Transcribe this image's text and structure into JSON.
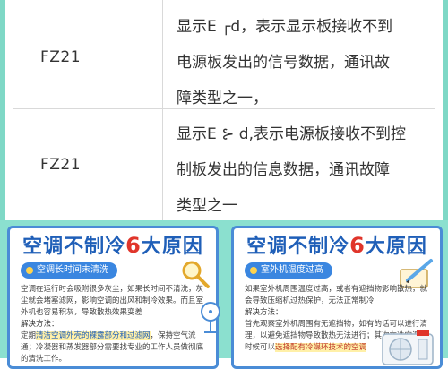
{
  "table": {
    "rows": [
      {
        "code": "FZ21",
        "desc_lines": [
          "显示E ┌d，表示显示板接收不到",
          "电源板发出的信号数据，通讯故",
          "障类型之一，"
        ]
      },
      {
        "code": "FZ21",
        "desc_lines": [
          "显示E ⊱ d,表示电源板接收不到控",
          "制板发出的信息数据，通讯故障",
          "类型之一"
        ]
      }
    ]
  },
  "infographic": {
    "left": {
      "title_a": "空调不制冷",
      "title_num": "6",
      "title_b": "大原因",
      "tag": "空调长时间未清洗",
      "p1": "空调在运行时会吸附很多灰尘，如果长时间不清洗，灰尘就会堵塞滤网，影响空调的出风和制冷效果。而且室外机也容易积灰，导致散热效果变差",
      "sol_label": "解决方法：",
      "sol_pre": "定期",
      "sol_hl": "清洁空调外壳的裸露部分和过滤网",
      "sol_post": "，保持空气流通；冷凝器和蒸发器部分需要找专业的工作人员做彻底的清洗工作。"
    },
    "right": {
      "title_a": "空调不制冷",
      "title_num": "6",
      "title_b": "大原因",
      "tag": "室外机温度过高",
      "p1": "如果室外机周围温度过高，或者有遮挡物影响散热，就会导致压缩机过热保护，无法正常制冷",
      "sol_label": "解决方法：",
      "sol_text": "首先观察室外机周围有无遮挡物，如有的话可以进行清理，以避免遮挡物导致散热无法进行；其次在选空调的时候可以",
      "sol_hl": "选择配有冷媒环技术的空调"
    }
  },
  "colors": {
    "frame": "#7fd8c6",
    "title_blue": "#1f5fb8",
    "accent_red": "#e0352b",
    "pill_blue": "#3a86e0"
  }
}
